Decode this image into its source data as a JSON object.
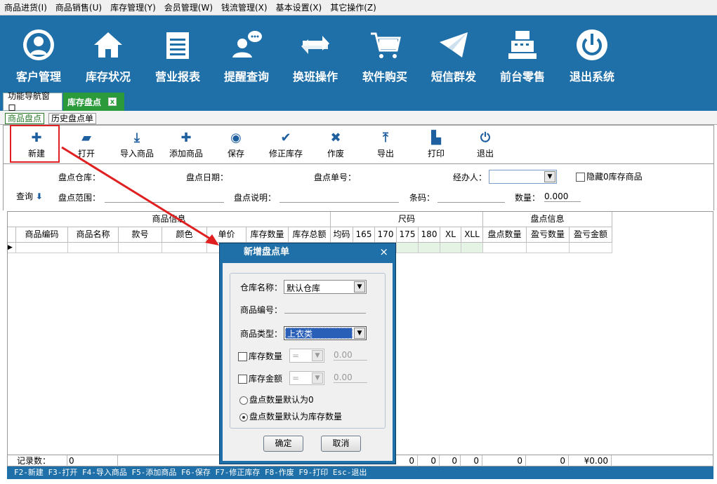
{
  "menu": [
    "商品进货(I)",
    "商品销售(U)",
    "库存管理(Y)",
    "会员管理(W)",
    "钱流管理(X)",
    "基本设置(X)",
    "其它操作(Z)"
  ],
  "banner": [
    {
      "label": "客户管理",
      "icon": "user-icon"
    },
    {
      "label": "库存状况",
      "icon": "home-icon"
    },
    {
      "label": "营业报表",
      "icon": "notepad-icon"
    },
    {
      "label": "提醒查询",
      "icon": "chat-user-icon"
    },
    {
      "label": "换班操作",
      "icon": "swap-icon"
    },
    {
      "label": "软件购买",
      "icon": "cart-icon"
    },
    {
      "label": "短信群发",
      "icon": "envelope-icon"
    },
    {
      "label": "前台零售",
      "icon": "cash-register-icon"
    },
    {
      "label": "退出系统",
      "icon": "power-icon"
    }
  ],
  "tabs": {
    "nav": "功能导航窗口",
    "active": "库存盘点",
    "close": "x"
  },
  "subtabs": [
    "商品盘点",
    "历史盘点单"
  ],
  "toolbar": [
    {
      "label": "新建",
      "glyph": "✚"
    },
    {
      "label": "打开",
      "glyph": "▰"
    },
    {
      "label": "导入商品",
      "glyph": "⤓"
    },
    {
      "label": "添加商品",
      "glyph": "✚"
    },
    {
      "label": "保存",
      "glyph": "◉"
    },
    {
      "label": "修正库存",
      "glyph": "✔"
    },
    {
      "label": "作废",
      "glyph": "✖"
    },
    {
      "label": "导出",
      "glyph": "⤒"
    },
    {
      "label": "打印",
      "glyph": "▙"
    },
    {
      "label": "退出",
      "glyph": "⏻"
    }
  ],
  "filters": {
    "warehouse": "盘点仓库：",
    "date": "盘点日期：",
    "number": "盘点单号：",
    "handler": "经办人：",
    "hide_zero": "隐藏0库存商品",
    "query": "查询",
    "range": "盘点范围：",
    "note": "盘点说明：",
    "barcode": "条码：",
    "qty_label": "数量：",
    "qty_value": "0.000"
  },
  "grid": {
    "groups": [
      "商品信息",
      "尺码",
      "盘点信息"
    ],
    "columns": [
      "商品编码",
      "商品名称",
      "款号",
      "颜色",
      "单价",
      "库存数量",
      "库存总额",
      "均码",
      "165",
      "170",
      "175",
      "180",
      "XL",
      "XLL",
      "盘点数量",
      "盈亏数量",
      "盈亏金额"
    ],
    "footer": {
      "label": "记录数：",
      "count": "0",
      "z1": "0",
      "z2": "0",
      "z3": "0",
      "z4": "0",
      "z5": "0",
      "z6": "0",
      "money": "¥0.00"
    }
  },
  "status": "F2-新建 F3-打开 F4-导入商品 F5-添加商品 F6-保存 F7-修正库存 F8-作废 F9-打印 Esc-退出",
  "dialog": {
    "title": "新增盘点单",
    "close": "×",
    "warehouse_label": "仓库名称：",
    "warehouse_value": "默认仓库",
    "code_label": "商品编号：",
    "type_label": "商品类型：",
    "type_value": "上衣类",
    "stock_qty_label": "库存数量",
    "stock_qty_op": "=",
    "stock_qty_value": "0.00",
    "stock_amt_label": "库存金额",
    "stock_amt_op": "=",
    "stock_amt_value": "0.00",
    "radio1": "盘点数量默认为0",
    "radio2": "盘点数量默认为库存数量",
    "ok": "确定",
    "cancel": "取消"
  },
  "colors": {
    "banner": "#1f6fa8",
    "active_tab": "#2a9a3a",
    "highlight": "#e02020"
  }
}
